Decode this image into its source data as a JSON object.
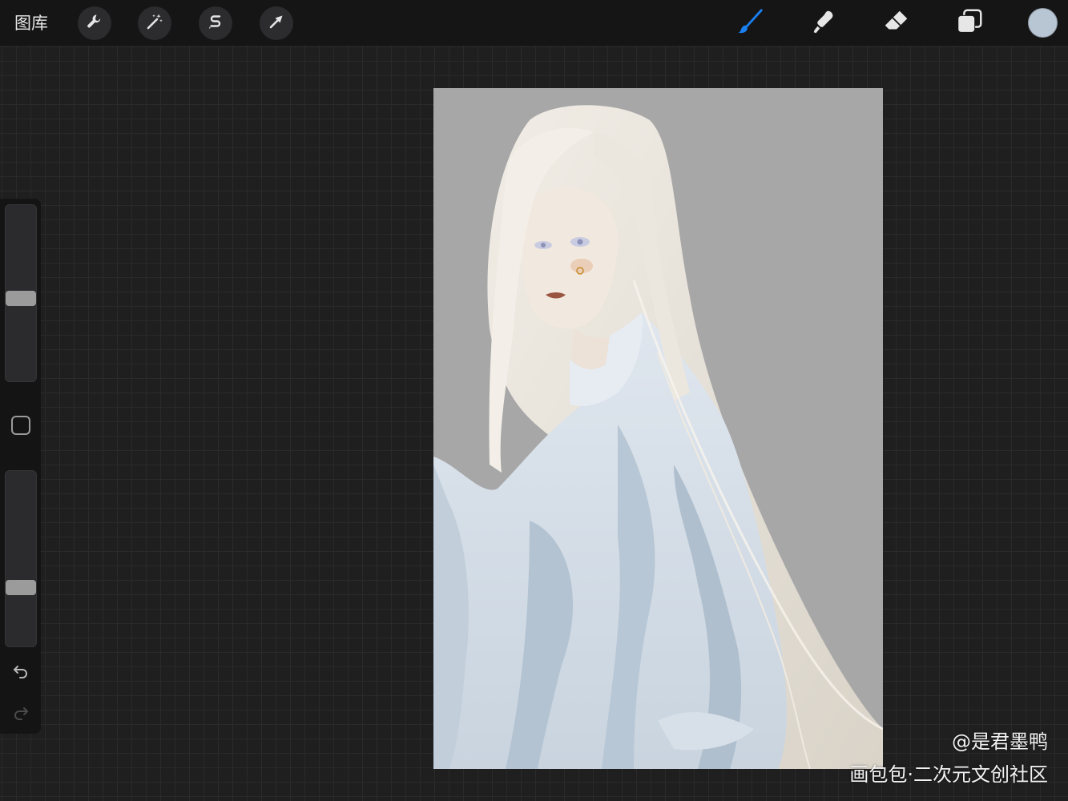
{
  "topbar": {
    "gallery_label": "图库",
    "actions": [
      {
        "name": "wrench-icon",
        "label": "Actions"
      },
      {
        "name": "magic-wand-icon",
        "label": "Adjustments"
      },
      {
        "name": "selection-s-icon",
        "label": "Selection"
      },
      {
        "name": "arrow-cursor-icon",
        "label": "Transform"
      }
    ],
    "tools": [
      {
        "name": "brush-icon",
        "active": true
      },
      {
        "name": "smudge-icon",
        "active": false
      },
      {
        "name": "eraser-icon",
        "active": false
      },
      {
        "name": "layers-icon",
        "active": false
      }
    ],
    "current_color": "#b8c5d3",
    "active_tool_color": "#1a7ff0"
  },
  "sidebar": {
    "brush_size_level": 0.53,
    "opacity_level": 0.68,
    "modify_icon": "square-icon",
    "undo_icon": "undo-arrow-icon",
    "redo_icon": "redo-arrow-icon"
  },
  "canvas": {
    "background_color": "#a7a7a7",
    "subject": "illustration-white-hair-figure"
  },
  "watermark": {
    "author": "@是君墨鸭",
    "site": "画包包·二次元文创社区"
  }
}
